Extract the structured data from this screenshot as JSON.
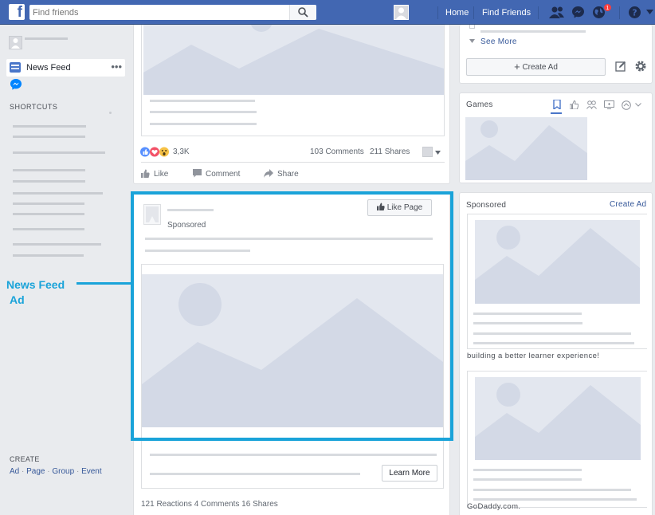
{
  "topbar": {
    "logo": "f",
    "search_placeholder": "Find friends",
    "home": "Home",
    "find_friends": "Find Friends",
    "notification_count": "1"
  },
  "left": {
    "news_feed": "News Feed",
    "shortcuts": "SHORTCUTS",
    "create": "CREATE",
    "create_links": [
      "Ad",
      "Page",
      "Group",
      "Event"
    ]
  },
  "annotation": {
    "line1": "News Feed",
    "line2": "Ad"
  },
  "post": {
    "reactions": "3,3K",
    "comments": "103 Comments",
    "shares": "211 Shares",
    "like": "Like",
    "comment": "Comment",
    "share": "Share"
  },
  "ad": {
    "sponsored": "Sponsored",
    "like_page": "Like Page",
    "learn_more": "Learn More",
    "stats": "121 Reactions  4 Comments  16 Shares"
  },
  "right": {
    "see_more": "See More",
    "create_ad_button": "Create Ad",
    "games": "Games",
    "sponsored": "Sponsored",
    "create_ad_link": "Create Ad",
    "ad1_caption": "building a better learner experience!",
    "ad2_caption": "GoDaddy.com."
  },
  "colors": {
    "topbar": "#4267b2",
    "annotation": "#1aa3d9",
    "link": "#365899"
  }
}
